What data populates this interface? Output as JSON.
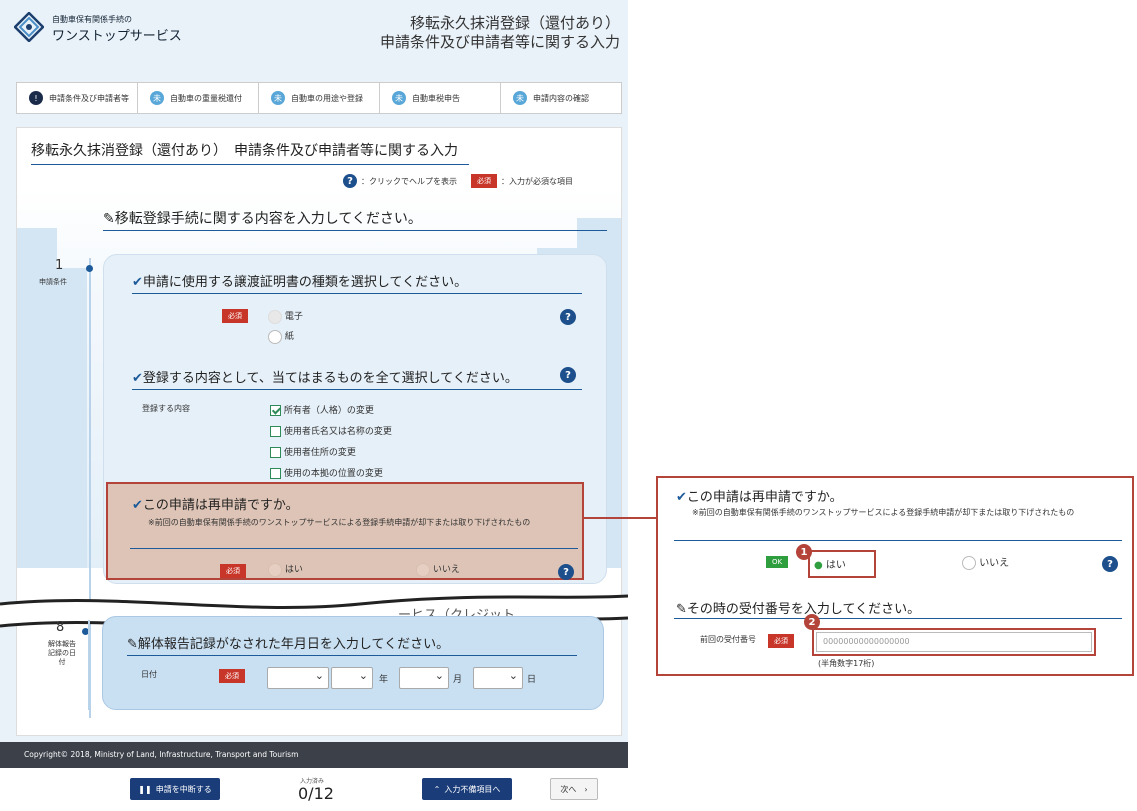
{
  "header": {
    "logo_line1": "自動車保有関係手続の",
    "logo_line2": "ワンストップサービス",
    "title_line1": "移転永久抹消登録（還付あり）",
    "title_line2": "申請条件及び申請者等に関する入力"
  },
  "steps": [
    {
      "icon": "!",
      "label": "申請条件及び申請者等"
    },
    {
      "icon": "未",
      "label": "自動車の重量税還付"
    },
    {
      "icon": "未",
      "label": "自動車の用途や登録"
    },
    {
      "icon": "未",
      "label": "自動車税申告"
    },
    {
      "icon": "未",
      "label": "申請内容の確認"
    }
  ],
  "main": {
    "heading": "移転永久抹消登録（還付あり）　申請条件及び申請者等に関する入力",
    "help_legend": "：クリックでヘルプを表示",
    "required_legend": "：入力が必須な項目",
    "required_tag": "必須",
    "section_heading": "移転登録手続に関する内容を入力してください。",
    "step1_number": "1",
    "step1_label": "申請条件",
    "q1": "申請に使用する譲渡証明書の種類を選択してください。",
    "q1_opt1": "電子",
    "q1_opt2": "紙",
    "q2": "登録する内容として、当てはまるものを全て選択してください。",
    "q2_label": "登録する内容",
    "q2_opts": [
      {
        "label": "所有者（人格）の変更",
        "checked": true
      },
      {
        "label": "使用者氏名又は名称の変更",
        "checked": false
      },
      {
        "label": "使用者住所の変更",
        "checked": false
      },
      {
        "label": "使用の本拠の位置の変更",
        "checked": false
      }
    ],
    "q3": "この申請は再申請ですか。",
    "q3_note": "※前回の自動車保有関係手続のワンストップサービスによる登録手続申請が却下または取り下げされたもの",
    "q3_yes": "はい",
    "q3_no": "いいえ",
    "cut_text": "ーヒス（クレジット",
    "step8_number": "8",
    "step8_label": "解体報告記録の日付",
    "q8": "解体報告記録がなされた年月日を入力してください。",
    "q8_label": "日付",
    "year_unit": "年",
    "month_unit": "月",
    "day_unit": "日"
  },
  "footer": {
    "copyright": "Copyright© 2018, Ministry of Land, Infrastructure, Transport and Tourism"
  },
  "bottom": {
    "suspend": "申請を中断する",
    "progress_label": "入力済み",
    "progress_value": "0/12",
    "incomplete": "入力不備項目へ",
    "next": "次へ　›"
  },
  "zoom": {
    "q": "この申請は再申請ですか。",
    "note": "※前回の自動車保有関係手続のワンストップサービスによる登録手続申請が却下または取り下げされたもの",
    "ok_tag": "OK",
    "yes": "はい",
    "no": "いいえ",
    "badge1": "1",
    "badge2": "2",
    "q2": "その時の受付番号を入力してください。",
    "field_label": "前回の受付番号",
    "required_tag": "必須",
    "field_value": "00000000000000000",
    "field_hint": "(半角数字17桁)"
  }
}
